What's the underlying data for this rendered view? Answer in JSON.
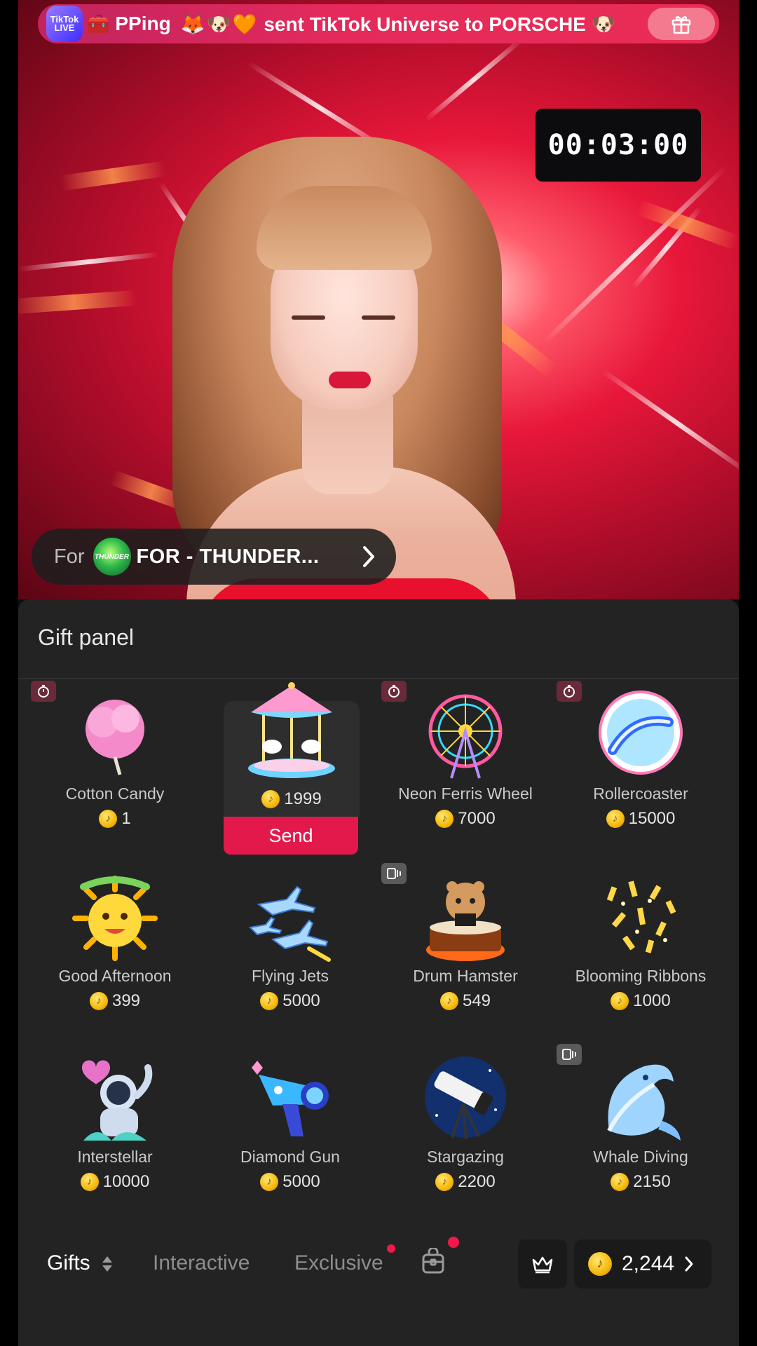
{
  "banner": {
    "logo_text": "TikTok LIVE",
    "sender": "PPing",
    "emoji": "🦊🐶🧡",
    "message": "sent TikTok Universe to PORSCHE 🐶"
  },
  "timer": {
    "value": "00:03:00"
  },
  "recipient": {
    "for_label": "For",
    "logo_text": "THUNDER",
    "name": "FOR - THUNDER..."
  },
  "panel": {
    "title": "Gift panel",
    "send_label": "Send",
    "gifts": [
      {
        "name": "Cotton Candy",
        "price": "1",
        "icon": "cotton-candy-icon",
        "badge": "timer"
      },
      {
        "name": "",
        "price": "1999",
        "icon": "carousel-icon",
        "selected": true
      },
      {
        "name": "Neon Ferris Wheel",
        "price": "7000",
        "icon": "ferris-wheel-icon",
        "badge": "timer"
      },
      {
        "name": "Rollercoaster",
        "price": "15000",
        "icon": "rollercoaster-icon",
        "badge": "timer"
      },
      {
        "name": "Good Afternoon",
        "price": "399",
        "icon": "sun-icon"
      },
      {
        "name": "Flying Jets",
        "price": "5000",
        "icon": "jets-icon"
      },
      {
        "name": "Drum Hamster",
        "price": "549",
        "icon": "hamster-icon",
        "badge": "video"
      },
      {
        "name": "Blooming Ribbons",
        "price": "1000",
        "icon": "ribbons-icon"
      },
      {
        "name": "Interstellar",
        "price": "10000",
        "icon": "astronaut-icon"
      },
      {
        "name": "Diamond Gun",
        "price": "5000",
        "icon": "diamond-gun-icon"
      },
      {
        "name": "Stargazing",
        "price": "2200",
        "icon": "telescope-icon"
      },
      {
        "name": "Whale Diving",
        "price": "2150",
        "icon": "whale-icon",
        "badge": "video"
      }
    ]
  },
  "tabs": {
    "gifts": "Gifts",
    "interactive": "Interactive",
    "exclusive": "Exclusive"
  },
  "wallet": {
    "balance": "2,244"
  },
  "colors": {
    "accent": "#e2194a",
    "panel_bg": "#232323",
    "coin": "#f5b80a"
  }
}
